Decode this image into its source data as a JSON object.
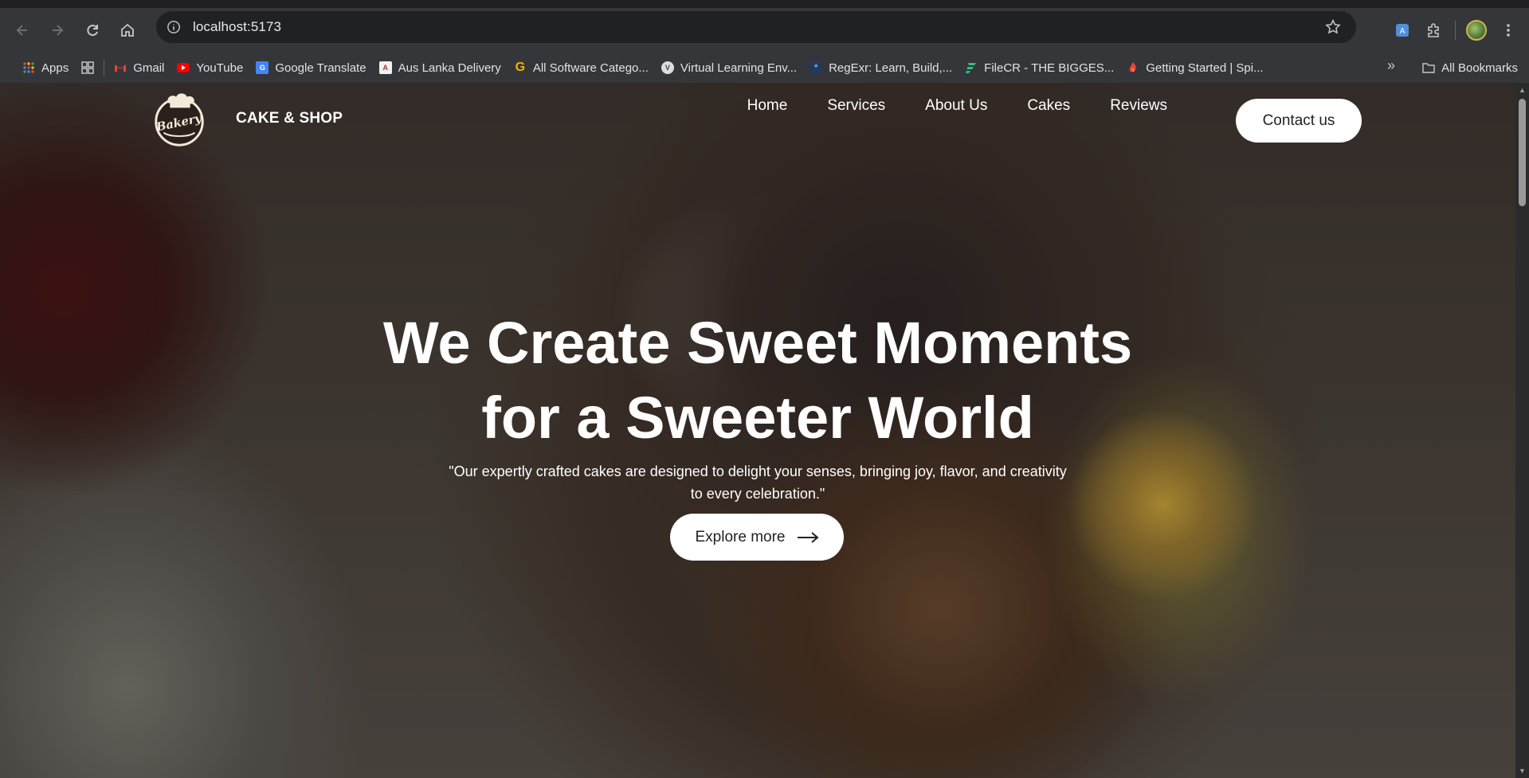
{
  "browser": {
    "url": "localhost:5173",
    "bookmarks": [
      {
        "label": "Apps",
        "icon": "apps-grid-icon"
      },
      {
        "label": "",
        "icon": "tab-groups-icon"
      },
      {
        "label": "Gmail",
        "icon": "gmail-icon"
      },
      {
        "label": "YouTube",
        "icon": "youtube-icon"
      },
      {
        "label": "Google Translate",
        "icon": "google-translate-icon"
      },
      {
        "label": "Aus Lanka Delivery",
        "icon": "aus-lanka-icon"
      },
      {
        "label": "All Software Catego...",
        "icon": "g-icon"
      },
      {
        "label": "Virtual Learning Env...",
        "icon": "vle-icon"
      },
      {
        "label": "RegExr: Learn, Build,...",
        "icon": "regexr-icon"
      },
      {
        "label": "FileCR - THE BIGGES...",
        "icon": "filecr-icon"
      },
      {
        "label": "Getting Started | Spi...",
        "icon": "spinnaker-icon"
      }
    ],
    "all_bookmarks_label": "All Bookmarks"
  },
  "site": {
    "brand_name": "CAKE & SHOP",
    "logo_text": "Bakery",
    "nav": {
      "home": "Home",
      "services": "Services",
      "about": "About Us",
      "cakes": "Cakes",
      "reviews": "Reviews",
      "contact": "Contact us"
    },
    "hero": {
      "title_line1": "We Create Sweet Moments",
      "title_line2": "for a Sweeter World",
      "subtitle_line1": "\"Our expertly crafted cakes are designed to delight your senses, bringing joy, flavor, and creativity",
      "subtitle_line2": "to every celebration.\"",
      "cta": "Explore more"
    }
  }
}
